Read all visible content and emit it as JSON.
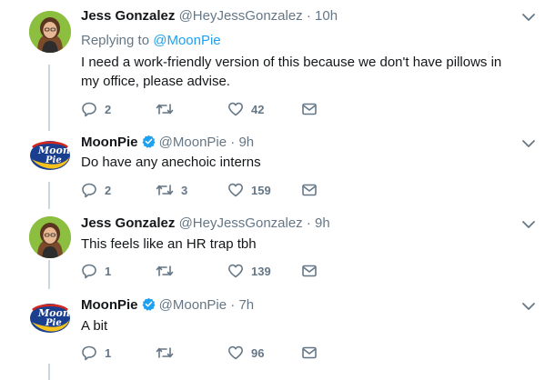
{
  "tweets": [
    {
      "author": "Jess Gonzalez",
      "handle": "@HeyJessGonzalez",
      "time": "10h",
      "replying_prefix": "Replying to",
      "replying_to": "@MoonPie",
      "text": "I need a work-friendly version of this because we don't have pillows in my office, please advise.",
      "replies": "2",
      "retweets": "",
      "likes": "42",
      "verified": false,
      "avatar": "jess-avatar"
    },
    {
      "author": "MoonPie",
      "handle": "@MoonPie",
      "time": "9h",
      "text": "Do have any anechoic interns",
      "replies": "2",
      "retweets": "3",
      "likes": "159",
      "verified": true,
      "avatar": "moonpie-avatar"
    },
    {
      "author": "Jess Gonzalez",
      "handle": "@HeyJessGonzalez",
      "time": "9h",
      "text": "This feels like an HR trap tbh",
      "replies": "1",
      "retweets": "",
      "likes": "139",
      "verified": false,
      "avatar": "jess-avatar"
    },
    {
      "author": "MoonPie",
      "handle": "@MoonPie",
      "time": "7h",
      "text": "A bit",
      "replies": "1",
      "retweets": "",
      "likes": "96",
      "verified": true,
      "avatar": "moonpie-avatar"
    }
  ],
  "colors": {
    "link": "#1da1f2",
    "muted": "#657786",
    "thread_line": "#ccd6dd",
    "verified": "#1da1f2"
  },
  "icons": [
    "reply-icon",
    "retweet-icon",
    "like-icon",
    "dm-icon",
    "chevron-down-icon",
    "verified-badge-icon"
  ]
}
